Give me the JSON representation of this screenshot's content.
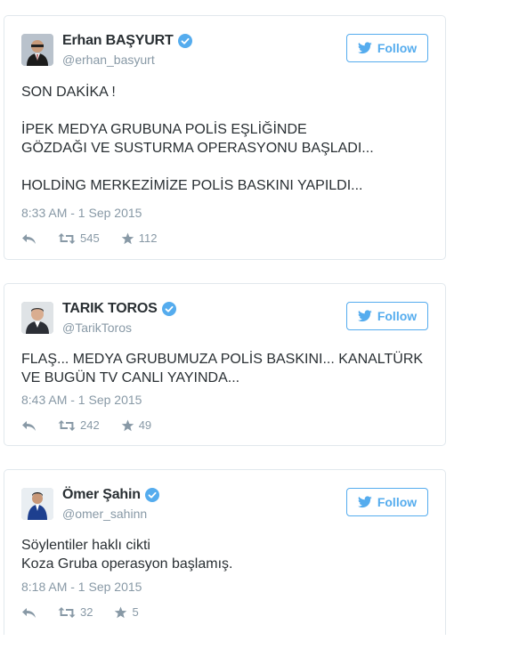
{
  "follow_label": "Follow",
  "colors": {
    "accent": "#55acee",
    "text": "#292f33",
    "muted": "#8899a6",
    "border": "#e1e8ed"
  },
  "tweets": [
    {
      "author_name": "Erhan BAŞYURT",
      "handle": "@erhan_basyurt",
      "lines": [
        "SON DAKİKA !",
        "",
        "İPEK MEDYA GRUBUNA POLİS EŞLİĞİNDE",
        "GÖZDAĞI VE SUSTURMA OPERASYONU BAŞLADI...",
        "",
        "HOLDİNG MERKEZİMİZE POLİS BASKINI YAPILDI..."
      ],
      "timestamp": "8:33 AM - 1 Sep 2015",
      "retweets": "545",
      "likes": "112"
    },
    {
      "author_name": "TARIK TOROS",
      "handle": "@TarikToros",
      "lines": [
        "FLAŞ... MEDYA GRUBUMUZA POLİS BASKINI... KANALTÜRK",
        "VE BUGÜN TV CANLI YAYINDA..."
      ],
      "timestamp": "8:43 AM - 1 Sep 2015",
      "retweets": "242",
      "likes": "49"
    },
    {
      "author_name": "Ömer Şahin",
      "handle": "@omer_sahinn",
      "lines": [
        "Söylentiler haklı cikti",
        "Koza Gruba operasyon başlamış."
      ],
      "timestamp": "8:18 AM - 1 Sep 2015",
      "retweets": "32",
      "likes": "5"
    }
  ]
}
